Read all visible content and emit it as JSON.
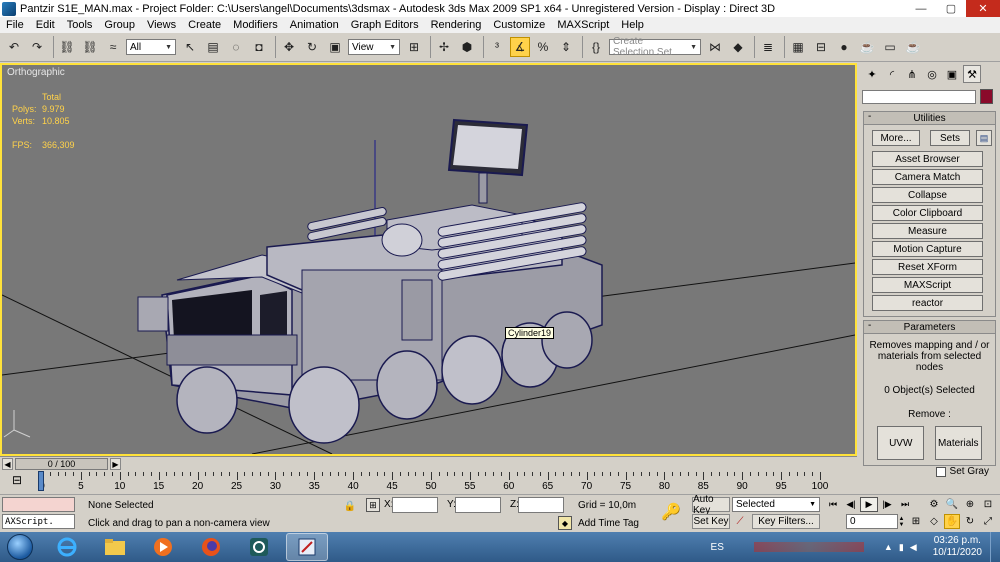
{
  "window": {
    "title": "Pantzir S1E_MAN.max    - Project Folder: C:\\Users\\angel\\Documents\\3dsmax     - Autodesk 3ds Max  2009 SP1  x64   - Unregistered Version      - Display : Direct 3D",
    "minimize": "—",
    "maximize": "▢",
    "close": "✕"
  },
  "menu": [
    "File",
    "Edit",
    "Tools",
    "Group",
    "Views",
    "Create",
    "Modifiers",
    "Animation",
    "Graph Editors",
    "Rendering",
    "Customize",
    "MAXScript",
    "Help"
  ],
  "toolbar": {
    "selection_filter": "All",
    "ref_coord": "View",
    "named_selection_placeholder": "Create Selection Set"
  },
  "viewport": {
    "label": "Orthographic",
    "stats_header": "Total",
    "polys_label": "Polys:",
    "polys_value": "9.979",
    "verts_label": "Verts:",
    "verts_value": "10.805",
    "fps_label": "FPS:",
    "fps_value": "366,309",
    "tooltip": "Cylinder19"
  },
  "command_panel": {
    "color_swatch": "#8a0a2a",
    "utilities": {
      "title": "Utilities",
      "more": "More...",
      "sets": "Sets",
      "items": [
        "Asset Browser",
        "Camera Match",
        "Collapse",
        "Color Clipboard",
        "Measure",
        "Motion Capture",
        "Reset XForm",
        "MAXScript",
        "reactor"
      ]
    },
    "parameters": {
      "title": "Parameters",
      "description": "Removes mapping and / or materials from selected nodes",
      "count": "0 Object(s) Selected",
      "remove_label": "Remove :",
      "uvw": "UVW",
      "materials": "Materials",
      "set_gray": "Set Gray"
    }
  },
  "timeline": {
    "frame_display": "0 / 100",
    "ticks": [
      "0",
      "5",
      "10",
      "15",
      "20",
      "25",
      "30",
      "35",
      "40",
      "45",
      "50",
      "55",
      "60",
      "65",
      "70",
      "75",
      "80",
      "85",
      "90",
      "95",
      "100"
    ]
  },
  "status": {
    "maxscript": "AXScript.",
    "selection": "None Selected",
    "prompt": "Click and drag to pan a non-camera view",
    "x_label": "X:",
    "y_label": "Y:",
    "z_label": "Z:",
    "grid": "Grid = 10,0m",
    "add_time_tag": "Add Time Tag",
    "auto_key": "Auto Key",
    "set_key": "Set Key",
    "selected": "Selected",
    "key_filters": "Key Filters...",
    "current_frame": "0"
  },
  "taskbar": {
    "language": "ES",
    "time": "03:26 p.m.",
    "date": "10/11/2020"
  }
}
